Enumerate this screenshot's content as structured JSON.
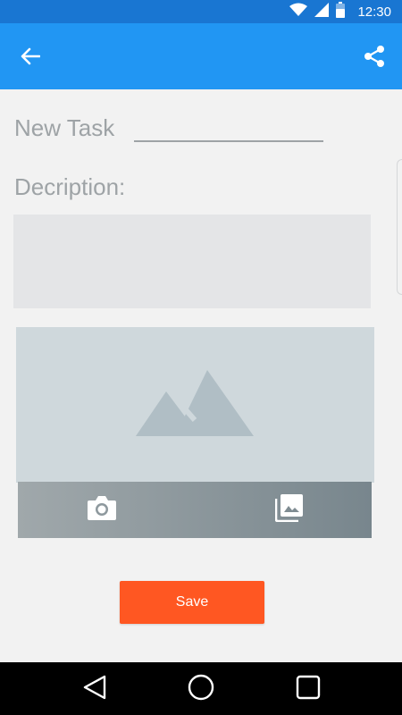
{
  "status_bar": {
    "time": "12:30",
    "icons": [
      "wifi-icon",
      "cell-signal-icon",
      "battery-icon"
    ]
  },
  "app_bar": {
    "color": "#2196f3",
    "left_icon": "arrow-back-icon",
    "right_icon": "share-icon"
  },
  "form": {
    "task_label": "New Task",
    "task_value": "",
    "description_label": "Decription:",
    "description_value": ""
  },
  "image_section": {
    "placeholder_icon": "image-placeholder-icon",
    "toolbar_icons": [
      "camera-icon",
      "photo-library-icon"
    ]
  },
  "actions": {
    "save_label": "Save",
    "save_color": "#ff5722"
  },
  "nav_bar": {
    "icons": [
      "nav-back-icon",
      "nav-home-icon",
      "nav-recents-icon"
    ]
  }
}
